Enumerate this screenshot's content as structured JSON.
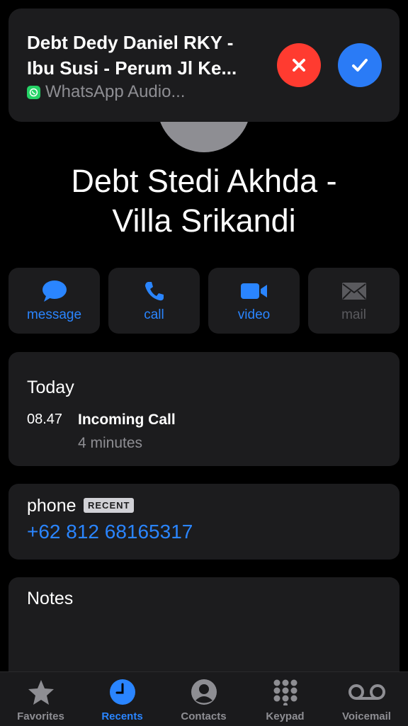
{
  "notification": {
    "title_line1": "Debt Dedy Daniel RKY -",
    "title_line2": "Ibu Susi - Perum Jl Ke...",
    "app_label": "WhatsApp Audio...",
    "decline_icon": "close-icon",
    "accept_icon": "checkmark-icon",
    "decline_color": "#ff3b30",
    "accept_color": "#2a7bf6"
  },
  "contact": {
    "name_line1": "Debt Stedi Akhda -",
    "name_line2": "Villa Srikandi"
  },
  "actions": [
    {
      "label": "message",
      "icon": "message-bubble-icon",
      "enabled": true
    },
    {
      "label": "call",
      "icon": "phone-icon",
      "enabled": true
    },
    {
      "label": "video",
      "icon": "video-camera-icon",
      "enabled": true
    },
    {
      "label": "mail",
      "icon": "envelope-icon",
      "enabled": false
    }
  ],
  "recents": {
    "day": "Today",
    "time": "08.47",
    "call_type": "Incoming Call",
    "duration": "4 minutes"
  },
  "phone": {
    "label": "phone",
    "badge": "RECENT",
    "number": "+62 812 68165317"
  },
  "notes": {
    "label": "Notes"
  },
  "tabbar": {
    "tabs": [
      {
        "label": "Favorites",
        "icon": "star-icon",
        "active": false
      },
      {
        "label": "Recents",
        "icon": "clock-icon",
        "active": true
      },
      {
        "label": "Contacts",
        "icon": "person-circle-icon",
        "active": false
      },
      {
        "label": "Keypad",
        "icon": "keypad-icon",
        "active": false
      },
      {
        "label": "Voicemail",
        "icon": "voicemail-icon",
        "active": false
      }
    ]
  },
  "colors": {
    "accent": "#2a85ff",
    "background": "#000000",
    "card": "#1c1c1e",
    "secondary_text": "#8e8e93"
  }
}
